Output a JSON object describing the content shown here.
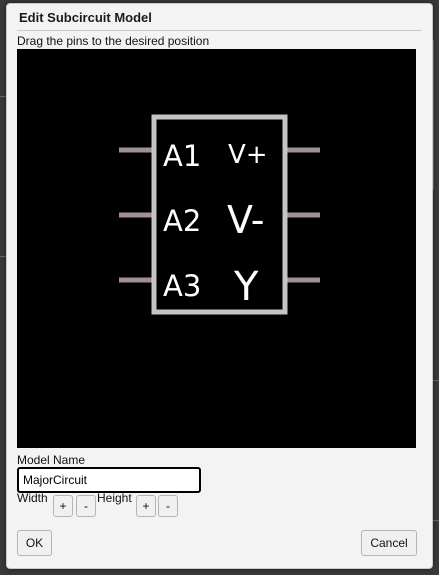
{
  "dialog": {
    "title": "Edit Subcircuit Model",
    "instruction": "Drag the pins to the desired position"
  },
  "chip": {
    "left_pins": [
      "A1",
      "A2",
      "A3"
    ],
    "right_pins": [
      "V+",
      "V-",
      "Y"
    ],
    "colors": {
      "body_border": "#c4c4c4",
      "pin": "#a09090",
      "text": "#ffffff",
      "canvas": "#000000"
    }
  },
  "model": {
    "label": "Model Name",
    "value": "MajorCircuit"
  },
  "size": {
    "width_label": "Width",
    "height_label": "Height",
    "plus": "+",
    "minus": "-"
  },
  "buttons": {
    "ok": "OK",
    "cancel": "Cancel"
  }
}
